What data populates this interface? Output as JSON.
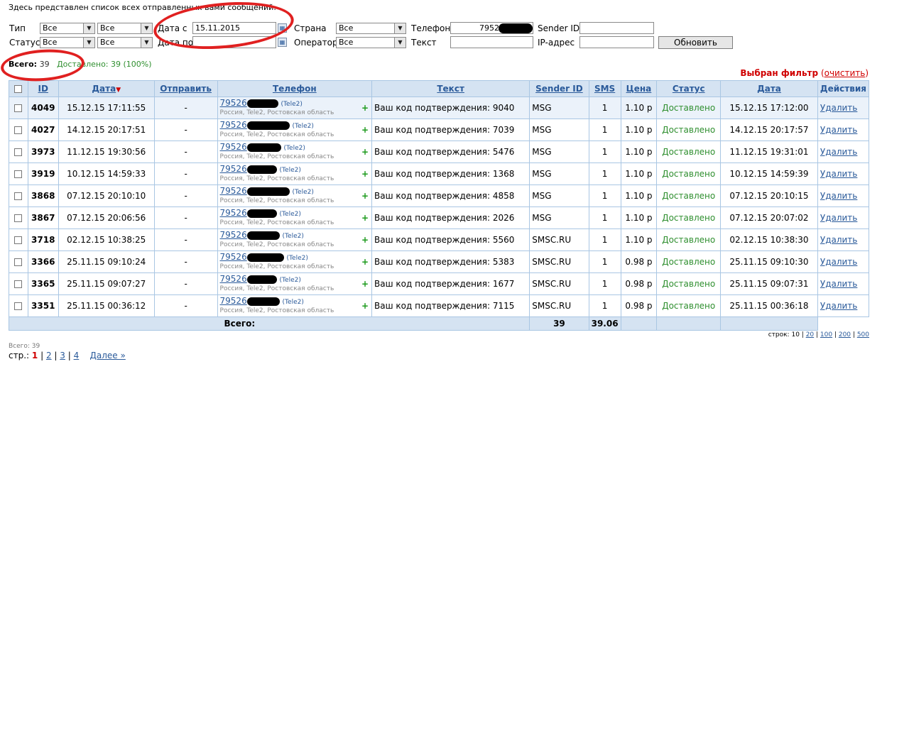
{
  "intro": "Здесь представлен список всех отправленных вами сообщений:",
  "filters": {
    "type_label": "Тип",
    "type_value": "Все",
    "type_value2": "Все",
    "status_label": "Статус",
    "status_value": "Все",
    "status_value2": "Все",
    "date_from_label": "Дата с",
    "date_from_value": "15.11.2015",
    "date_to_label": "Дата по",
    "date_to_value": "",
    "country_label": "Страна",
    "country_value": "Все",
    "operator_label": "Оператор",
    "operator_value": "Все",
    "phone_label": "Телефон",
    "phone_value": "79526",
    "text_label": "Текст",
    "text_value": "",
    "sender_label": "Sender ID",
    "sender_value": "",
    "ip_label": "IP-адрес",
    "ip_value": "",
    "refresh_button": "Обновить"
  },
  "summary": {
    "total_label": "Всего:",
    "total": "39",
    "delivered": "Доставлено: 39 (100%)"
  },
  "filter_info": {
    "selected": "Выбран фильтр",
    "clear": "очистить"
  },
  "columns": [
    "ID",
    "Дата",
    "Отправить",
    "Телефон",
    "Текст",
    "Sender ID",
    "SMS",
    "Цена",
    "Статус",
    "Дата",
    "Действия"
  ],
  "sort_indicator": "▼",
  "rows": [
    {
      "id": "4049",
      "date": "15.12.15 17:11:55",
      "send": "-",
      "phone": "79526",
      "operator": "(Tele2)",
      "region": "Россия, Tele2, Ростовская область",
      "plus": "+",
      "text": "Ваш код подтверждения: 9040",
      "sender": "MSG",
      "sms": "1",
      "price": "1.10 р",
      "status": "Доставлено",
      "date2": "15.12.15 17:12:00",
      "action": "Удалить"
    },
    {
      "id": "4027",
      "date": "14.12.15 20:17:51",
      "send": "-",
      "phone": "79526",
      "operator": "(Tele2)",
      "region": "Россия, Tele2, Ростовская область",
      "plus": "+",
      "text": "Ваш код подтверждения: 7039",
      "sender": "MSG",
      "sms": "1",
      "price": "1.10 р",
      "status": "Доставлено",
      "date2": "14.12.15 20:17:57",
      "action": "Удалить"
    },
    {
      "id": "3973",
      "date": "11.12.15 19:30:56",
      "send": "-",
      "phone": "79526",
      "operator": "(Tele2)",
      "region": "Россия, Tele2, Ростовская область",
      "plus": "+",
      "text": "Ваш код подтверждения: 5476",
      "sender": "MSG",
      "sms": "1",
      "price": "1.10 р",
      "status": "Доставлено",
      "date2": "11.12.15 19:31:01",
      "action": "Удалить"
    },
    {
      "id": "3919",
      "date": "10.12.15 14:59:33",
      "send": "-",
      "phone": "79526",
      "operator": "(Tele2)",
      "region": "Россия, Tele2, Ростовская область",
      "plus": "+",
      "text": "Ваш код подтверждения: 1368",
      "sender": "MSG",
      "sms": "1",
      "price": "1.10 р",
      "status": "Доставлено",
      "date2": "10.12.15 14:59:39",
      "action": "Удалить"
    },
    {
      "id": "3868",
      "date": "07.12.15 20:10:10",
      "send": "-",
      "phone": "79526",
      "operator": "(Tele2)",
      "region": "Россия, Tele2, Ростовская область",
      "plus": "+",
      "text": "Ваш код подтверждения: 4858",
      "sender": "MSG",
      "sms": "1",
      "price": "1.10 р",
      "status": "Доставлено",
      "date2": "07.12.15 20:10:15",
      "action": "Удалить"
    },
    {
      "id": "3867",
      "date": "07.12.15 20:06:56",
      "send": "-",
      "phone": "79526",
      "operator": "(Tele2)",
      "region": "Россия, Tele2, Ростовская область",
      "plus": "+",
      "text": "Ваш код подтверждения: 2026",
      "sender": "MSG",
      "sms": "1",
      "price": "1.10 р",
      "status": "Доставлено",
      "date2": "07.12.15 20:07:02",
      "action": "Удалить"
    },
    {
      "id": "3718",
      "date": "02.12.15 10:38:25",
      "send": "-",
      "phone": "79526",
      "operator": "(Tele2)",
      "region": "Россия, Tele2, Ростовская область",
      "plus": "+",
      "text": "Ваш код подтверждения: 5560",
      "sender": "SMSC.RU",
      "sms": "1",
      "price": "1.10 р",
      "status": "Доставлено",
      "date2": "02.12.15 10:38:30",
      "action": "Удалить"
    },
    {
      "id": "3366",
      "date": "25.11.15 09:10:24",
      "send": "-",
      "phone": "79526",
      "operator": "(Tele2)",
      "region": "Россия, Tele2, Ростовская область",
      "plus": "+",
      "text": "Ваш код подтверждения: 5383",
      "sender": "SMSC.RU",
      "sms": "1",
      "price": "0.98 р",
      "status": "Доставлено",
      "date2": "25.11.15 09:10:30",
      "action": "Удалить"
    },
    {
      "id": "3365",
      "date": "25.11.15 09:07:27",
      "send": "-",
      "phone": "79526",
      "operator": "(Tele2)",
      "region": "Россия, Tele2, Ростовская область",
      "plus": "+",
      "text": "Ваш код подтверждения: 1677",
      "sender": "SMSC.RU",
      "sms": "1",
      "price": "0.98 р",
      "status": "Доставлено",
      "date2": "25.11.15 09:07:31",
      "action": "Удалить"
    },
    {
      "id": "3351",
      "date": "25.11.15 00:36:12",
      "send": "-",
      "phone": "79526",
      "operator": "(Tele2)",
      "region": "Россия, Tele2, Ростовская область",
      "plus": "+",
      "text": "Ваш код подтверждения: 7115",
      "sender": "SMSC.RU",
      "sms": "1",
      "price": "0.98 р",
      "status": "Доставлено",
      "date2": "25.11.15 00:36:18",
      "action": "Удалить"
    }
  ],
  "footer_row": {
    "label": "Всего:",
    "sms": "39",
    "price": "39.06"
  },
  "rows_per_page": {
    "label": "строк:",
    "current": "10",
    "options": [
      "20",
      "100",
      "200",
      "500"
    ]
  },
  "total_small": "Всего: 39",
  "pagination": {
    "label": "стр.:",
    "current": "1",
    "pages": [
      "2",
      "3",
      "4"
    ],
    "next": "Далее »"
  },
  "colors": {
    "header_bg": "#d5e3f2",
    "link": "#2a5a9a",
    "delivered": "#2f8f2f",
    "alert": "#d00000",
    "annotation": "#e02020"
  }
}
